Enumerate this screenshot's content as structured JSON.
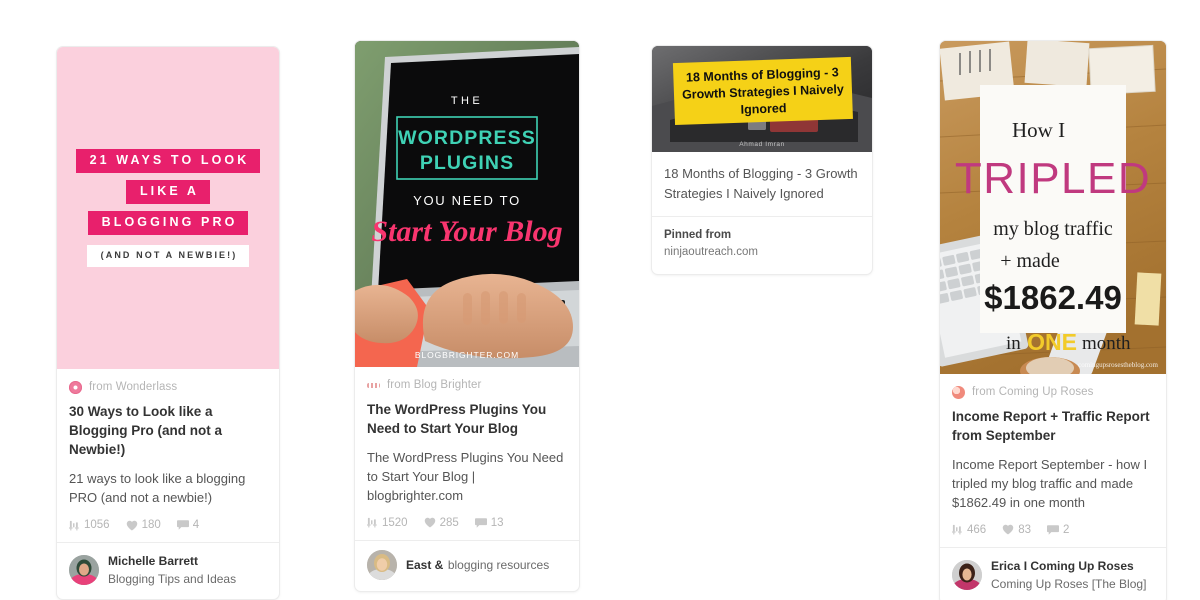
{
  "page": {
    "background": "#ffffff",
    "layout": "pinterest-pin-grid",
    "columns": 4
  },
  "colors": {
    "accent_pink": "#e8206c",
    "pale_pink": "#fbd0dd",
    "teal": "#3fd2b5",
    "hot_pink": "#f9356f",
    "yellow": "#f5d117",
    "text_dark": "#333333",
    "text_muted": "#b5b5b5",
    "card_border": "#ececec"
  },
  "pins": [
    {
      "id": "pin-blogging-pro",
      "source": {
        "icon": "site-favicon-icon",
        "label": "from Wonderlass"
      },
      "title": "30 Ways to Look like a Blogging Pro (and not a Newbie!)",
      "description": "21 ways to look like a blogging PRO (and not a newbie!)",
      "stats": {
        "saves_icon": "pin-save-icon",
        "saves": "1056",
        "likes_icon": "heart-icon",
        "likes": "180",
        "comments_icon": "comment-bubble-icon",
        "comments": "4"
      },
      "pinner": {
        "avatar": "avatar",
        "name": "Michelle Barrett",
        "board": "Blogging Tips and Ideas"
      },
      "art": {
        "kind": "text-poster",
        "background": "#fbd0dd",
        "lines": [
          {
            "text": "21 WAYS TO LOOK",
            "style": "pink-bar"
          },
          {
            "text": "LIKE A",
            "style": "pink-bar"
          },
          {
            "text": "BLOGGING PRO",
            "style": "pink-bar"
          },
          {
            "text": "(AND NOT A NEWBIE!)",
            "style": "white-bar"
          }
        ]
      }
    },
    {
      "id": "pin-wordpress-plugins",
      "source": {
        "icon": "site-favicon-icon",
        "label": "from Blog Brighter"
      },
      "title": "The WordPress Plugins You Need to Start Your Blog",
      "description": "The WordPress Plugins You Need to Start Your Blog | blogbrighter.com",
      "stats": {
        "saves_icon": "pin-save-icon",
        "saves": "1520",
        "likes_icon": "heart-icon",
        "likes": "285",
        "comments_icon": "comment-bubble-icon",
        "comments": "13"
      },
      "pinner": {
        "avatar": "avatar",
        "name": "East &",
        "board": "blogging resources"
      },
      "art": {
        "kind": "photo-laptop",
        "overlay_lines": [
          "THE",
          "WORDPRESS",
          "PLUGINS",
          "YOU NEED TO",
          "Start Your Blog"
        ],
        "watermark": "BLOGBRIGHTER.COM"
      }
    },
    {
      "id": "pin-18-months-blogging",
      "source": null,
      "title": "18 Months of Blogging - 3 Growth Strategies I Naively Ignored",
      "description": null,
      "stats": null,
      "pinned_from": {
        "label": "Pinned from",
        "domain": "ninjaoutreach.com"
      },
      "art": {
        "kind": "photo-sticky-note",
        "note_color": "#f5d117",
        "overlay_lines": [
          "18 Months of Blogging - 3",
          "Growth Strategies I Naively",
          "Ignored"
        ],
        "byline": "Ahmad Imran"
      }
    },
    {
      "id": "pin-income-report",
      "source": {
        "icon": "site-favicon-icon",
        "label": "from Coming Up Roses"
      },
      "title": "Income Report + Traffic Report from September",
      "description": "Income Report September - how I tripled my blog traffic and made $1862.49 in one month",
      "stats": {
        "saves_icon": "pin-save-icon",
        "saves": "466",
        "likes_icon": "heart-icon",
        "likes": "83",
        "comments_icon": "comment-bubble-icon",
        "comments": "2"
      },
      "pinner": {
        "avatar": "avatar",
        "name": "Erica I Coming Up Roses",
        "board": "Coming Up Roses [The Blog]"
      },
      "art": {
        "kind": "photo-wood-desk",
        "overlay_lines": [
          "How I",
          "TRIPLED",
          "my blog traffic",
          "+ made",
          "$1862.49",
          "in",
          "ONE",
          "month"
        ],
        "watermark": "comingupsrosestheblog.com"
      }
    }
  ]
}
